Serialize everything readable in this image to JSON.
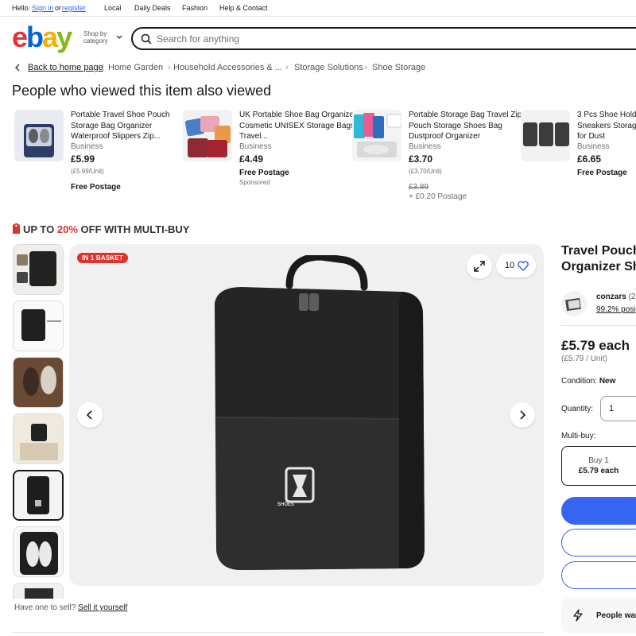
{
  "topbar": {
    "hello": "Hello.",
    "signin": "Sign in",
    "or": "or",
    "register": "register",
    "links": [
      "Local",
      "Daily Deals",
      "Fashion",
      "Help & Contact"
    ]
  },
  "header": {
    "logo": [
      "e",
      "b",
      "a",
      "y"
    ],
    "shop_by": "Shop by",
    "category": "category",
    "search_placeholder": "Search for anything"
  },
  "breadcrumb": {
    "back": "Back to home page",
    "items": [
      "Home Garden",
      "Household Accessories & ...",
      "Storage Solutions",
      "Shoe Storage"
    ]
  },
  "also_viewed": {
    "title": "People who viewed this item also viewed",
    "items": [
      {
        "title": "Portable Travel Shoe Pouch Storage Bag Organizer Waterproof Slippers Zip...",
        "condition": "Business",
        "price": "£5.99",
        "unit": "(£5.99/Unit)",
        "postage": "Free Postage"
      },
      {
        "title": "UK Portable Shoe Bag Organizer Cosmetic UNISEX Storage Bags Travel...",
        "condition": "Business",
        "price": "£4.49",
        "postage": "Free Postage",
        "sponsored": "Sponsored"
      },
      {
        "title": "Portable Storage Bag Travel Zip Pouch Storage Shoes Bag Dustproof Organizer",
        "condition": "Business",
        "price": "£3.70",
        "unit": "(£3.70/Unit)",
        "was": "£3.89",
        "postage": "+ £0.20 Postage"
      },
      {
        "title": "3 Pcs Shoe Holder Sneakers Storage for Dust",
        "condition": "Business",
        "price": "£6.65",
        "postage": "Free Postage"
      }
    ]
  },
  "promo": {
    "prefix": "UP TO ",
    "percent": "20%",
    "suffix": " OFF WITH MULTI-BUY"
  },
  "gallery": {
    "badge": "IN 1 BASKET",
    "watch_count": "10",
    "bag_label": "SHOES"
  },
  "sell": {
    "text": "Have one to sell?",
    "link": "Sell it yourself"
  },
  "product": {
    "title_line1": "Travel Pouch",
    "title_line2": "Organizer Sh",
    "seller": "conzars",
    "seller_count": "(2",
    "positive": "99.2% posi",
    "price": "£5.79 each",
    "unit": "(£5.79 / Unit)",
    "condition_label": "Condition:",
    "condition_value": "New",
    "quantity_label": "Quantity:",
    "quantity_value": "1",
    "multibuy_label": "Multi-buy:",
    "multibuy_buy": "Buy 1",
    "multibuy_price": "£5.79 each",
    "people_text": "People war"
  },
  "colors": {
    "ebay_red": "#e53238",
    "ebay_blue": "#0064d2",
    "ebay_yellow": "#f5af02",
    "ebay_green": "#86b817",
    "accent_blue": "#3665f3",
    "promo_red": "#e0312f"
  }
}
